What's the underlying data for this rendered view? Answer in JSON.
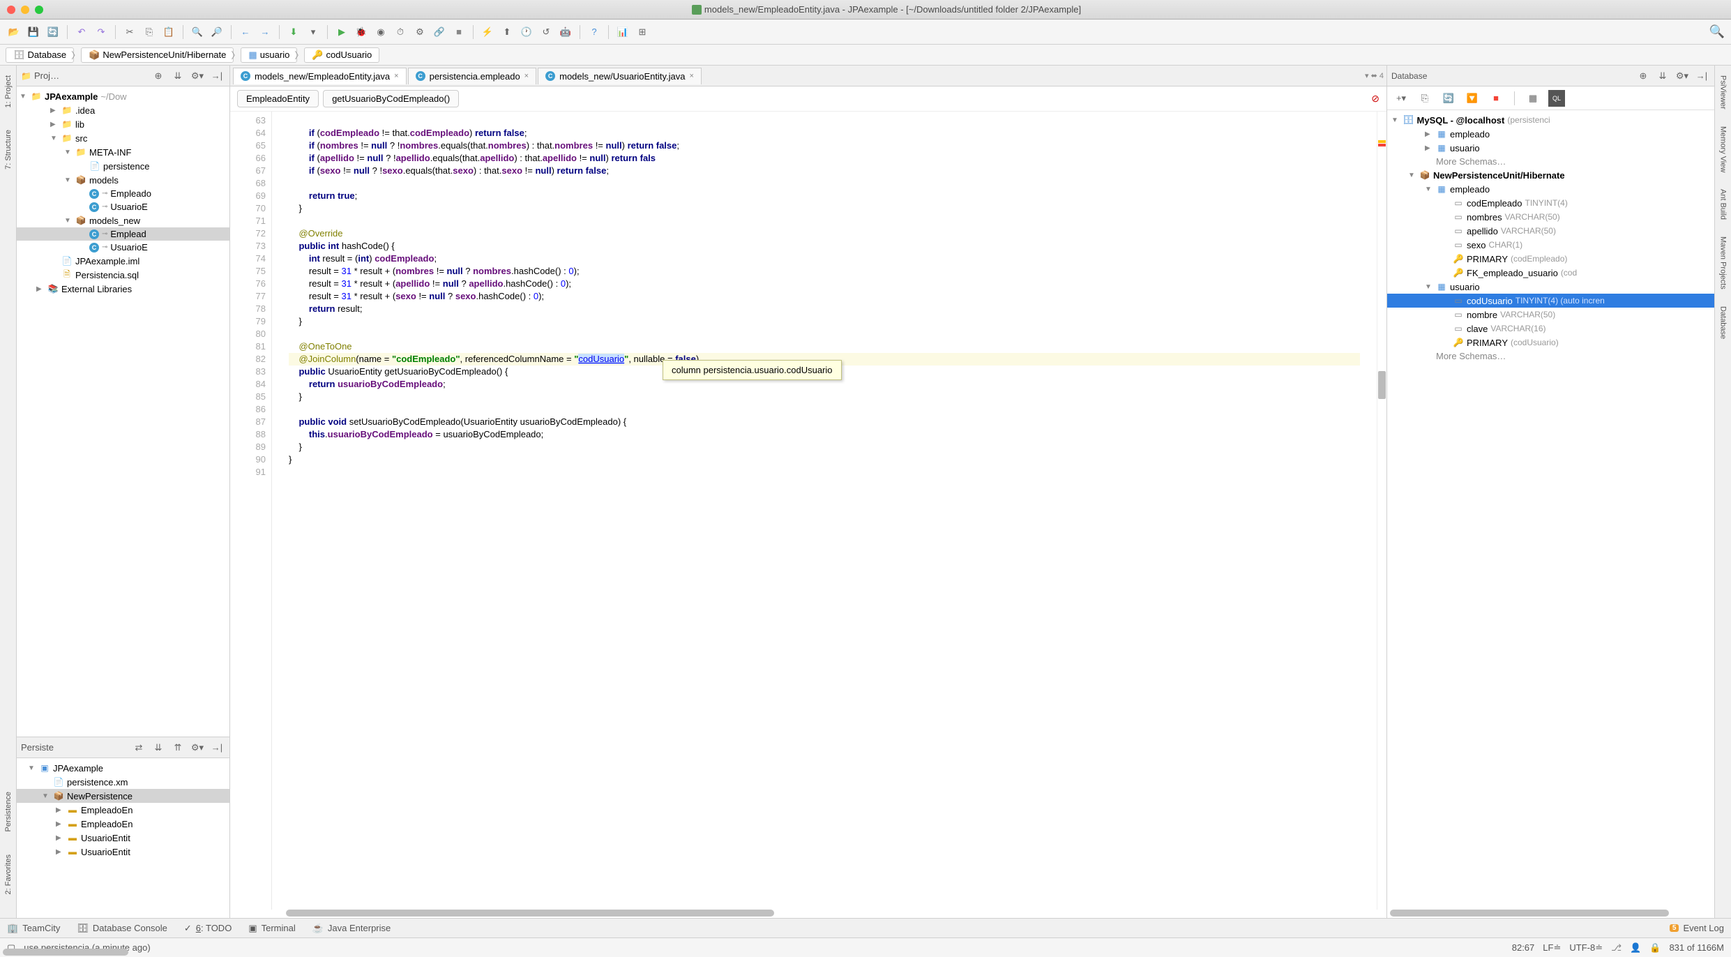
{
  "title": "models_new/EmpleadoEntity.java - JPAexample - [~/Downloads/untitled folder 2/JPAexample]",
  "nav": [
    "Database",
    "NewPersistenceUnit/Hibernate",
    "usuario",
    "codUsuario"
  ],
  "projectPanel": {
    "title": "Proj…",
    "root": "JPAexample",
    "rootPath": "~/Dow",
    "items": [
      {
        "indent": 1,
        "arrow": "▶",
        "icon": "folder",
        "label": ".idea"
      },
      {
        "indent": 1,
        "arrow": "▶",
        "icon": "folder",
        "label": "lib"
      },
      {
        "indent": 1,
        "arrow": "▼",
        "icon": "folder-src",
        "label": "src"
      },
      {
        "indent": 2,
        "arrow": "▼",
        "icon": "folder-pkg",
        "label": "META-INF"
      },
      {
        "indent": 3,
        "arrow": "",
        "icon": "xml",
        "label": "persistence"
      },
      {
        "indent": 2,
        "arrow": "▼",
        "icon": "package",
        "label": "models"
      },
      {
        "indent": 3,
        "arrow": "",
        "icon": "class",
        "label": "Empleado"
      },
      {
        "indent": 3,
        "arrow": "",
        "icon": "class",
        "label": "UsuarioE"
      },
      {
        "indent": 2,
        "arrow": "▼",
        "icon": "package",
        "label": "models_new"
      },
      {
        "indent": 3,
        "arrow": "",
        "icon": "class",
        "label": "Emplead",
        "selected": true
      },
      {
        "indent": 3,
        "arrow": "",
        "icon": "class",
        "label": "UsuarioE"
      },
      {
        "indent": 1,
        "arrow": "",
        "icon": "iml",
        "label": "JPAexample.iml"
      },
      {
        "indent": 1,
        "arrow": "",
        "icon": "sql",
        "label": "Persistencia.sql"
      },
      {
        "indent": 0,
        "arrow": "▶",
        "icon": "lib",
        "label": "External Libraries"
      }
    ]
  },
  "persistPanel": {
    "title": "Persiste",
    "items": [
      {
        "indent": 0,
        "arrow": "▼",
        "icon": "module",
        "label": "JPAexample"
      },
      {
        "indent": 1,
        "arrow": "",
        "icon": "xml",
        "label": "persistence.xm"
      },
      {
        "indent": 1,
        "arrow": "▼",
        "icon": "pu",
        "label": "NewPersistence",
        "selected": true
      },
      {
        "indent": 2,
        "arrow": "▶",
        "icon": "entity",
        "label": "EmpleadoEn"
      },
      {
        "indent": 2,
        "arrow": "▶",
        "icon": "entity",
        "label": "EmpleadoEn"
      },
      {
        "indent": 2,
        "arrow": "▶",
        "icon": "entity",
        "label": "UsuarioEntit"
      },
      {
        "indent": 2,
        "arrow": "▶",
        "icon": "entity",
        "label": "UsuarioEntit"
      }
    ]
  },
  "tabs": [
    {
      "icon": "class",
      "label": "models_new/EmpleadoEntity.java",
      "active": true,
      "close": true
    },
    {
      "icon": "class",
      "label": "persistencia.empleado",
      "close": true
    },
    {
      "icon": "class",
      "label": "models_new/UsuarioEntity.java",
      "close": true
    }
  ],
  "tabsRight": "▾ ⬌ 4",
  "breadcrumb": [
    "EmpleadoEntity",
    "getUsuarioByCodEmpleado()"
  ],
  "lineStart": 63,
  "lineEnd": 91,
  "tooltip": "column persistencia.usuario.codUsuario",
  "dbPanel": {
    "title": "Database",
    "root": "MySQL - @localhost",
    "rootSuffix": "(persistenci",
    "items": [
      {
        "indent": 1,
        "arrow": "▶",
        "icon": "table",
        "label": "empleado"
      },
      {
        "indent": 1,
        "arrow": "▶",
        "icon": "table",
        "label": "usuario"
      },
      {
        "indent": 1,
        "arrow": "",
        "icon": "",
        "label": "More Schemas…",
        "muted": true
      },
      {
        "indent": 0,
        "arrow": "▼",
        "icon": "pu",
        "label": "NewPersistenceUnit/Hibernate",
        "bold": true
      },
      {
        "indent": 1,
        "arrow": "▼",
        "icon": "table",
        "label": "empleado"
      },
      {
        "indent": 2,
        "arrow": "",
        "icon": "col",
        "label": "codEmpleado",
        "type": "TINYINT(4)"
      },
      {
        "indent": 2,
        "arrow": "",
        "icon": "col",
        "label": "nombres",
        "type": "VARCHAR(50)"
      },
      {
        "indent": 2,
        "arrow": "",
        "icon": "col",
        "label": "apellido",
        "type": "VARCHAR(50)"
      },
      {
        "indent": 2,
        "arrow": "",
        "icon": "col",
        "label": "sexo",
        "type": "CHAR(1)"
      },
      {
        "indent": 2,
        "arrow": "",
        "icon": "key",
        "label": "PRIMARY",
        "type": "(codEmpleado)"
      },
      {
        "indent": 2,
        "arrow": "",
        "icon": "fk",
        "label": "FK_empleado_usuario",
        "type": "(cod"
      },
      {
        "indent": 1,
        "arrow": "▼",
        "icon": "table",
        "label": "usuario"
      },
      {
        "indent": 2,
        "arrow": "",
        "icon": "col",
        "label": "codUsuario",
        "type": "TINYINT(4) (auto incren",
        "selected": true
      },
      {
        "indent": 2,
        "arrow": "",
        "icon": "col",
        "label": "nombre",
        "type": "VARCHAR(50)"
      },
      {
        "indent": 2,
        "arrow": "",
        "icon": "col",
        "label": "clave",
        "type": "VARCHAR(16)"
      },
      {
        "indent": 2,
        "arrow": "",
        "icon": "key",
        "label": "PRIMARY",
        "type": "(codUsuario)"
      },
      {
        "indent": 1,
        "arrow": "",
        "icon": "",
        "label": "More Schemas…",
        "muted": true
      }
    ]
  },
  "bottomTabs": [
    {
      "icon": "tc",
      "label": "TeamCity"
    },
    {
      "icon": "db",
      "label": "Database Console"
    },
    {
      "icon": "todo",
      "label": "6: TODO",
      "underline": "6"
    },
    {
      "icon": "term",
      "label": "Terminal"
    },
    {
      "icon": "jee",
      "label": "Java Enterprise"
    }
  ],
  "eventLog": {
    "count": "5",
    "label": "Event Log"
  },
  "status": {
    "msg": "use persistencia (a minute ago)",
    "pos": "82:67",
    "lf": "LF≐",
    "enc": "UTF-8≐",
    "mem": "831 of 1166M"
  },
  "leftGutterTabs": [
    "1: Project",
    "7: Structure",
    "Persistence",
    "2: Favorites"
  ],
  "rightGutterTabs": [
    "PsiViewer",
    "Memory View",
    "Ant Build",
    "Maven Projects",
    "Database"
  ]
}
